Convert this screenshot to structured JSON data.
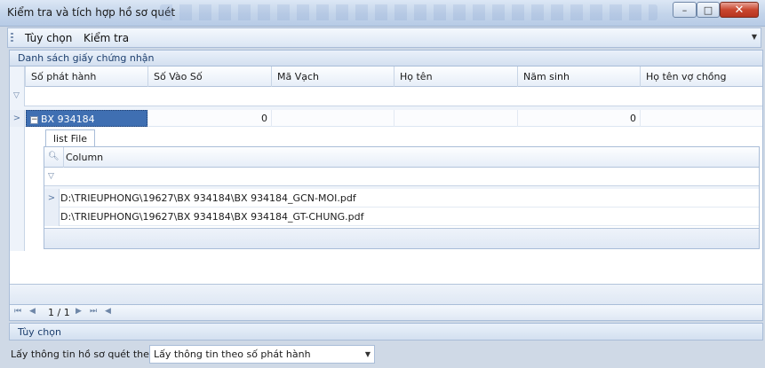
{
  "window": {
    "title": "Kiểm tra và tích hợp hồ sơ quét",
    "controls": {
      "minimize": "–",
      "maximize": "□",
      "close": "✕"
    }
  },
  "menu": {
    "items": [
      {
        "label": "Tùy chọn"
      },
      {
        "label": "Kiểm tra"
      }
    ]
  },
  "certificate_list": {
    "group_title": "Danh sách giấy chứng nhận",
    "columns": [
      "Số phát hành",
      "Số Vào Số",
      "Mã Vạch",
      "Họ tên",
      "Năm sinh",
      "Họ tên vợ chồng"
    ],
    "rows": [
      {
        "so_phat_hanh": "BX 934184",
        "so_vao_so": "0",
        "ma_vach": "",
        "ho_ten": "",
        "nam_sinh": "0",
        "ho_ten_vo_chong": ""
      }
    ],
    "detail": {
      "tab_label": "list File",
      "column": "Column",
      "files": [
        "D:\\TRIEUPHONG\\19627\\BX 934184\\BX 934184_GCN-MOI.pdf",
        "D:\\TRIEUPHONG\\19627\\BX 934184\\BX 934184_GT-CHUNG.pdf"
      ]
    }
  },
  "navigator": {
    "page": "1 / 1"
  },
  "options": {
    "title": "Tùy chọn",
    "label": "Lấy thông tin hồ sơ quét theo:",
    "selected": "Lấy thông tin theo số phát hành"
  }
}
